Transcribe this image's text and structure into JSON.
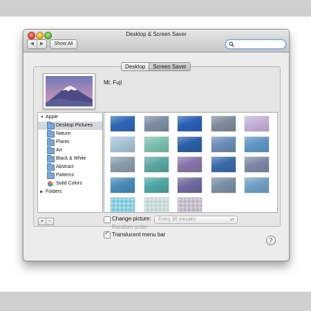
{
  "window": {
    "title": "Desktop & Screen Saver",
    "nav": {
      "back": "◀",
      "forward": "▶"
    },
    "show_all_label": "Show All",
    "search_placeholder": ""
  },
  "tabs": [
    {
      "label": "Desktop",
      "selected": true
    },
    {
      "label": "Screen Saver",
      "selected": false
    }
  ],
  "preview": {
    "name": "Mt. Fuji"
  },
  "source_list": {
    "items": [
      {
        "label": "Apple",
        "kind": "group",
        "expanded": true
      },
      {
        "label": "Desktop Pictures",
        "kind": "folder",
        "selected": true
      },
      {
        "label": "Nature",
        "kind": "folder"
      },
      {
        "label": "Plants",
        "kind": "folder"
      },
      {
        "label": "Art",
        "kind": "folder"
      },
      {
        "label": "Black & White",
        "kind": "folder"
      },
      {
        "label": "Abstract",
        "kind": "folder"
      },
      {
        "label": "Patterns",
        "kind": "folder"
      },
      {
        "label": "Solid Colors",
        "kind": "colors"
      },
      {
        "label": "Folders",
        "kind": "group",
        "expanded": false
      }
    ],
    "add_label": "+",
    "remove_label": "−"
  },
  "thumbnails": [
    [
      "#2f67b6",
      "#7d8ea3",
      "#2a5fb8",
      "#7f8c9b",
      "#c4b0d9"
    ],
    [
      "#a9c3d6",
      "#7cbfae",
      "#2b5fa8",
      "#6b8cb6",
      "#5f95c4"
    ],
    [
      "#8a9caa",
      "#5aa6a4",
      "#8873a9",
      "#3a6aa8",
      "#7c88a8"
    ],
    [
      "#4a8bb8",
      "#4da6a5",
      "#6d6a9e",
      "#7b8fa6",
      "#6fa0c4"
    ],
    [
      "#6fc2d8",
      "#bcd2d4",
      "#b8acc1"
    ]
  ],
  "options": {
    "change_picture_label": "Change picture:",
    "change_picture_checked": false,
    "interval_value": "Every 30 minutes",
    "random_order_label": "Random order",
    "random_order_checked": false,
    "translucent_label": "Translucent menu bar",
    "translucent_checked": true
  },
  "help_label": "?"
}
